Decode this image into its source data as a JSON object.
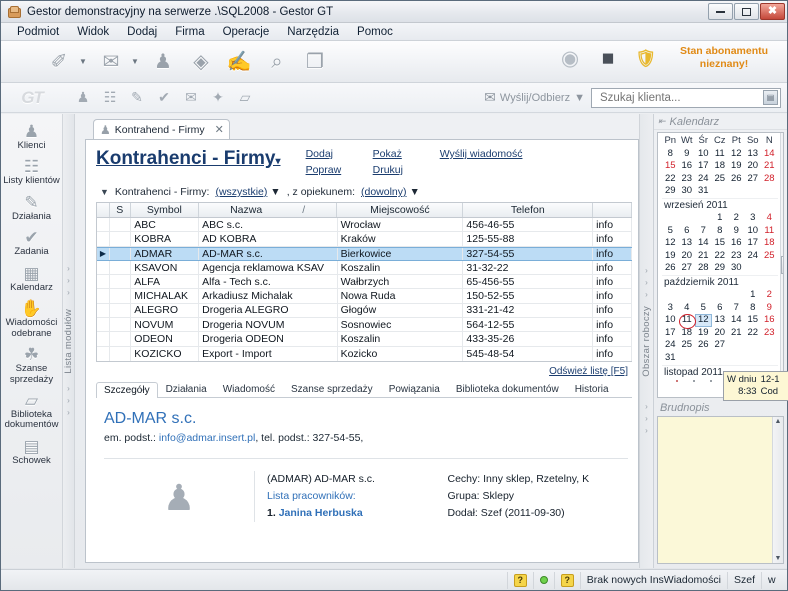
{
  "window": {
    "title": "Gestor demonstracyjny na serwerze .\\SQL2008 - Gestor GT",
    "icon": "app-icon",
    "minimize": "–",
    "maximize": "□",
    "close": "✕"
  },
  "menubar": {
    "items": [
      "Podmiot",
      "Widok",
      "Dodaj",
      "Firma",
      "Operacje",
      "Narzędzia",
      "Pomoc"
    ]
  },
  "toolbar": {
    "buttons": [
      {
        "name": "new-arrow-button",
        "glyph": "✐"
      },
      {
        "name": "open-folder-button",
        "glyph": "✉"
      },
      {
        "name": "contacts-button",
        "glyph": "♟"
      },
      {
        "name": "tag-button",
        "glyph": "◈"
      },
      {
        "name": "action-button",
        "glyph": "✍"
      },
      {
        "name": "search-button",
        "glyph": "⌕"
      },
      {
        "name": "print-button",
        "glyph": "❐"
      }
    ],
    "right_icons": [
      {
        "name": "globe-icon",
        "glyph": "◌"
      },
      {
        "name": "cube-icon",
        "glyph": "⬛"
      },
      {
        "name": "help-shield-icon",
        "glyph": "?"
      }
    ],
    "subscription_line1": "Stan abonamentu",
    "subscription_line2": "nieznany!",
    "subscription_color": "#e08a16"
  },
  "subbar": {
    "logo": "GT",
    "buttons": [
      {
        "name": "client-icon",
        "glyph": "♟"
      },
      {
        "name": "client-list-icon",
        "glyph": "☷"
      },
      {
        "name": "activity-icon",
        "glyph": "✎"
      },
      {
        "name": "task-icon",
        "glyph": "✔"
      },
      {
        "name": "mail-icon",
        "glyph": "✉"
      },
      {
        "name": "chance-icon",
        "glyph": "✦"
      },
      {
        "name": "doc-icon",
        "glyph": "▱"
      }
    ],
    "send_receive_label": "Wyślij/Odbierz",
    "send_receive_caret": "▼",
    "search_placeholder": "Szukaj klienta...",
    "search_value": "",
    "search_button_glyph": "▤"
  },
  "sidebar": {
    "vertical_label": "Lista modułów",
    "items": [
      {
        "label": "Klienci",
        "icon": "clients-icon",
        "glyph": "♟"
      },
      {
        "label": "Listy klientów",
        "icon": "client-lists-icon",
        "glyph": "☷"
      },
      {
        "label": "Działania",
        "icon": "actions-icon",
        "glyph": "✎"
      },
      {
        "label": "Zadania",
        "icon": "tasks-icon",
        "glyph": "✔"
      },
      {
        "label": "Kalendarz",
        "icon": "calendar-icon",
        "glyph": "▦"
      },
      {
        "label": "Wiadomości odebrane",
        "icon": "inbox-icon",
        "glyph": "✋"
      },
      {
        "label": "Szanse sprzedaży",
        "icon": "sales-chances-icon",
        "glyph": "☘"
      },
      {
        "label": "Biblioteka dokumentów",
        "icon": "document-library-icon",
        "glyph": "▱"
      },
      {
        "label": "Schowek",
        "icon": "clipboard-icon",
        "glyph": "▤"
      }
    ]
  },
  "workspace": {
    "vertical_label": "Obszar roboczy",
    "tab": {
      "label": "Kontrahend - Firmy",
      "icon": "contractors-icon",
      "glyph": "♟",
      "close": "✕"
    },
    "page_title": "Kontrahenci - Firmy",
    "page_title_caret": "▾",
    "links": [
      "Dodaj",
      "Popraw",
      "Pokaż",
      "Drukuj",
      "Wyślij wiadomość"
    ],
    "filter": {
      "expander": "▼",
      "label": "Kontrahenci - Firmy:",
      "value1": "(wszystkie)",
      "separator": ", z opiekunem:",
      "value2": "(dowolny)",
      "caret": "▼"
    },
    "grid": {
      "columns": [
        "",
        "S",
        "Symbol",
        "Nazwa",
        "Miejscowość",
        "Telefon",
        ""
      ],
      "sort_indicator": "/",
      "rows": [
        {
          "marker": "",
          "s": "",
          "symbol": "ABC",
          "nazwa": "ABC s.c.",
          "miejscowosc": "Wrocław",
          "telefon": "456-46-55",
          "extra": "info",
          "selected": false
        },
        {
          "marker": "",
          "s": "",
          "symbol": "KOBRA",
          "nazwa": "AD KOBRA",
          "miejscowosc": "Kraków",
          "telefon": "125-55-88",
          "extra": "info",
          "selected": false
        },
        {
          "marker": "▶",
          "s": "",
          "symbol": "ADMAR",
          "nazwa": "AD-MAR s.c.",
          "miejscowosc": "Bierkowice",
          "telefon": "327-54-55",
          "extra": "info",
          "selected": true
        },
        {
          "marker": "",
          "s": "",
          "symbol": "KSAVON",
          "nazwa": "Agencja reklamowa KSAV",
          "miejscowosc": "Koszalin",
          "telefon": "31-32-22",
          "extra": "info",
          "selected": false
        },
        {
          "marker": "",
          "s": "",
          "symbol": "ALFA",
          "nazwa": "Alfa - Tech s.c.",
          "miejscowosc": "Wałbrzych",
          "telefon": "65-456-55",
          "extra": "info",
          "selected": false
        },
        {
          "marker": "",
          "s": "",
          "symbol": "MICHALAK",
          "nazwa": "Arkadiusz Michalak",
          "miejscowosc": "Nowa Ruda",
          "telefon": "150-52-55",
          "extra": "info",
          "selected": false
        },
        {
          "marker": "",
          "s": "",
          "symbol": "ALEGRO",
          "nazwa": "Drogeria ALEGRO",
          "miejscowosc": "Głogów",
          "telefon": "331-21-42",
          "extra": "info",
          "selected": false
        },
        {
          "marker": "",
          "s": "",
          "symbol": "NOVUM",
          "nazwa": "Drogeria NOVUM",
          "miejscowosc": "Sosnowiec",
          "telefon": "564-12-55",
          "extra": "info",
          "selected": false
        },
        {
          "marker": "",
          "s": "",
          "symbol": "ODEON",
          "nazwa": "Drogeria ODEON",
          "miejscowosc": "Koszalin",
          "telefon": "433-35-26",
          "extra": "info",
          "selected": false
        },
        {
          "marker": "",
          "s": "",
          "symbol": "KOZICKO",
          "nazwa": "Export - Import",
          "miejscowosc": "Kozicko",
          "telefon": "545-48-54",
          "extra": "info",
          "selected": false
        }
      ],
      "refresh_link": "Odśwież listę [F5]"
    },
    "detail_tabs": [
      {
        "label": "Szczegóły",
        "active": true
      },
      {
        "label": "Działania",
        "active": false
      },
      {
        "label": "Wiadomość",
        "active": false
      },
      {
        "label": "Szanse sprzedaży",
        "active": false
      },
      {
        "label": "Powiązania",
        "active": false
      },
      {
        "label": "Biblioteka dokumentów",
        "active": false
      },
      {
        "label": "Historia",
        "active": false
      }
    ],
    "detail": {
      "title": "AD-MAR s.c.",
      "email_label": "em. podst.:",
      "email": "info@admar.insert.pl",
      "phone_label": ", tel. podst.:",
      "phone": "327-54-55,",
      "photo_icon": "company-icon",
      "photo_glyph": "♟",
      "left_name": "(ADMAR) AD-MAR s.c.",
      "left_list_label": "Lista pracowników:",
      "left_employee_num": "1.",
      "left_employee": "Janina Herbuska",
      "right_features": "Cechy: Inny sklep, Rzetelny, K",
      "right_group": "Grupa: Sklepy",
      "right_added": "Dodał: Szef (2011-09-30)"
    }
  },
  "rightpanel": {
    "calendar_title": "Kalendarz",
    "pin_icon": "pin-icon",
    "pin_glyph": "⇤",
    "weekdays": [
      "Pn",
      "Wt",
      "Śr",
      "Cz",
      "Pt",
      "So",
      "N"
    ],
    "months": [
      {
        "label": "",
        "weeks": [
          [
            "8",
            "9",
            "10",
            "11",
            "12",
            "13",
            "14"
          ],
          [
            "15",
            "16",
            "17",
            "18",
            "19",
            "20",
            "21"
          ],
          [
            "22",
            "23",
            "24",
            "25",
            "26",
            "27",
            "28"
          ],
          [
            "29",
            "30",
            "31",
            "",
            "",
            "",
            ""
          ]
        ]
      },
      {
        "label": "wrzesień 2011",
        "weeks": [
          [
            "",
            "",
            "",
            "1",
            "2",
            "3",
            "4"
          ],
          [
            "5",
            "6",
            "7",
            "8",
            "9",
            "10",
            "11"
          ],
          [
            "12",
            "13",
            "14",
            "15",
            "16",
            "17",
            "18"
          ],
          [
            "19",
            "20",
            "21",
            "22",
            "23",
            "24",
            "25"
          ],
          [
            "26",
            "27",
            "28",
            "29",
            "30",
            "",
            ""
          ]
        ]
      },
      {
        "label": "październik 2011",
        "weeks": [
          [
            "",
            "",
            "",
            "",
            "",
            "1",
            "2"
          ],
          [
            "3",
            "4",
            "5",
            "6",
            "7",
            "8",
            "9"
          ],
          [
            "10",
            "11",
            "12",
            "13",
            "14",
            "15",
            "16"
          ],
          [
            "17",
            "18",
            "19",
            "20",
            "21",
            "22",
            "23"
          ],
          [
            "24",
            "25",
            "26",
            "27",
            "",
            "",
            ""
          ],
          [
            "31",
            "",
            "",
            "",
            "",
            "",
            ""
          ]
        ]
      },
      {
        "label": "listopad 2011",
        "weeks": []
      }
    ],
    "today": "11",
    "today_month": "październik 2011",
    "selected_day": "12",
    "scroll_up": "▲",
    "scroll_down": "▼",
    "notes_title": "Brudnopis",
    "notes_value": ""
  },
  "tooltip": {
    "line1_left": "W dniu",
    "line1_right": "12-1",
    "line2_left": "8:33",
    "line2_right": "Cod"
  },
  "statusbar": {
    "help_icon_1": "?",
    "status_dot": "online-dot",
    "help_icon_2": "?",
    "message": "Brak nowych InsWiadomości",
    "user": "Szef",
    "extra": "w"
  }
}
